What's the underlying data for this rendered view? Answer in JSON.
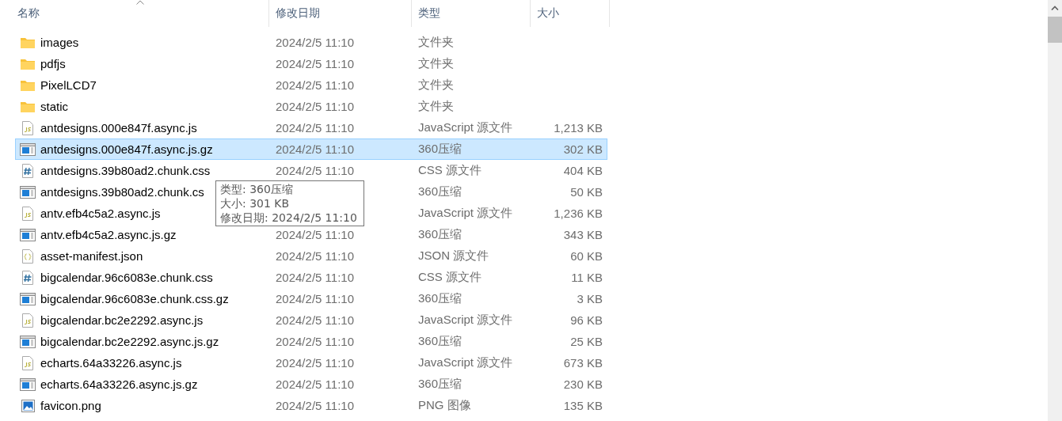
{
  "columns": [
    {
      "label": "名称",
      "sorted": true
    },
    {
      "label": "修改日期",
      "sorted": false
    },
    {
      "label": "类型",
      "sorted": false
    },
    {
      "label": "大小",
      "sorted": false
    }
  ],
  "rows": [
    {
      "kind": "folder",
      "name": "images",
      "date": "2024/2/5 11:10",
      "type": "文件夹",
      "selected": false
    },
    {
      "kind": "folder",
      "name": "pdfjs",
      "date": "2024/2/5 11:10",
      "type": "文件夹",
      "selected": false
    },
    {
      "kind": "folder",
      "name": "PixelLCD7",
      "date": "2024/2/5 11:10",
      "type": "文件夹",
      "selected": false
    },
    {
      "kind": "folder",
      "name": "static",
      "date": "2024/2/5 11:10",
      "type": "文件夹",
      "selected": false
    },
    {
      "kind": "js",
      "name": "antdesigns.000e847f.async.js",
      "date": "2024/2/5 11:10",
      "type": "JavaScript 源文件",
      "size": "1,213 KB",
      "selected": false
    },
    {
      "kind": "archive",
      "name": "antdesigns.000e847f.async.js.gz",
      "date": "2024/2/5 11:10",
      "type": "360压缩",
      "size": "302 KB",
      "selected": true
    },
    {
      "kind": "css",
      "name": "antdesigns.39b80ad2.chunk.css",
      "date": "2024/2/5 11:10",
      "type": "CSS 源文件",
      "size": "404 KB",
      "selected": false
    },
    {
      "kind": "archive",
      "name": "antdesigns.39b80ad2.chunk.cs",
      "type": "360压缩",
      "size": "50 KB",
      "selected": false
    },
    {
      "kind": "js",
      "name": "antv.efb4c5a2.async.js",
      "type": "JavaScript 源文件",
      "size": "1,236 KB",
      "selected": false
    },
    {
      "kind": "archive",
      "name": "antv.efb4c5a2.async.js.gz",
      "date": "2024/2/5 11:10",
      "type": "360压缩",
      "size": "343 KB",
      "selected": false
    },
    {
      "kind": "json",
      "name": "asset-manifest.json",
      "date": "2024/2/5 11:10",
      "type": "JSON 源文件",
      "size": "60 KB",
      "selected": false
    },
    {
      "kind": "css",
      "name": "bigcalendar.96c6083e.chunk.css",
      "date": "2024/2/5 11:10",
      "type": "CSS 源文件",
      "size": "11 KB",
      "selected": false
    },
    {
      "kind": "archive",
      "name": "bigcalendar.96c6083e.chunk.css.gz",
      "date": "2024/2/5 11:10",
      "type": "360压缩",
      "size": "3 KB",
      "selected": false
    },
    {
      "kind": "js",
      "name": "bigcalendar.bc2e2292.async.js",
      "date": "2024/2/5 11:10",
      "type": "JavaScript 源文件",
      "size": "96 KB",
      "selected": false
    },
    {
      "kind": "archive",
      "name": "bigcalendar.bc2e2292.async.js.gz",
      "date": "2024/2/5 11:10",
      "type": "360压缩",
      "size": "25 KB",
      "selected": false
    },
    {
      "kind": "js",
      "name": "echarts.64a33226.async.js",
      "date": "2024/2/5 11:10",
      "type": "JavaScript 源文件",
      "size": "673 KB",
      "selected": false
    },
    {
      "kind": "archive",
      "name": "echarts.64a33226.async.js.gz",
      "date": "2024/2/5 11:10",
      "type": "360压缩",
      "size": "230 KB",
      "selected": false
    },
    {
      "kind": "image",
      "name": "favicon.png",
      "date": "2024/2/5 11:10",
      "type": "PNG 图像",
      "size": "135 KB",
      "selected": false
    }
  ],
  "tooltip": {
    "lines": [
      "类型: 360压缩",
      "大小: 301 KB",
      "修改日期: 2024/2/5 11:10"
    ]
  }
}
